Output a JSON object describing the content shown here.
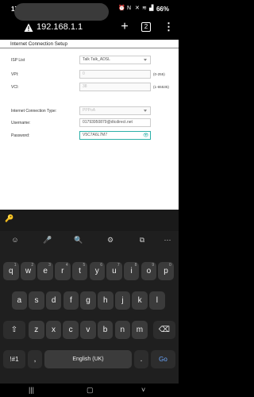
{
  "status_bar": {
    "time": "17:25",
    "battery": "66%"
  },
  "browser": {
    "url": "192.168.1.1",
    "tab_count": "2"
  },
  "form": {
    "title": "Internet Connection Setup",
    "isp_label": "ISP List",
    "isp_value": "Talk Talk_ADSL",
    "vpi_label": "VPI:",
    "vpi_value": "0",
    "vpi_range": "(0-255)",
    "vci_label": "VCI:",
    "vci_value": "38",
    "vci_range": "(1-65535)",
    "conn_type_label": "Internet Connection Type:",
    "conn_type_value": "PPPoA",
    "username_label": "Username:",
    "username_value": "01793950879@dtcdirect.net",
    "password_label": "Password:",
    "password_value": "V5C7A6L7M7"
  },
  "keyboard": {
    "row1": [
      {
        "k": "q",
        "n": "1"
      },
      {
        "k": "w",
        "n": "2"
      },
      {
        "k": "e",
        "n": "3"
      },
      {
        "k": "r",
        "n": "4"
      },
      {
        "k": "t",
        "n": "5"
      },
      {
        "k": "y",
        "n": "6"
      },
      {
        "k": "u",
        "n": "7"
      },
      {
        "k": "i",
        "n": "8"
      },
      {
        "k": "o",
        "n": "9"
      },
      {
        "k": "p",
        "n": "0"
      }
    ],
    "row2": [
      "a",
      "s",
      "d",
      "f",
      "g",
      "h",
      "j",
      "k",
      "l"
    ],
    "row3": [
      "z",
      "x",
      "c",
      "v",
      "b",
      "n",
      "m"
    ],
    "symbols_label": "!#1",
    "comma": ",",
    "period": ".",
    "space_label": "English (UK)",
    "go_label": "Go"
  }
}
